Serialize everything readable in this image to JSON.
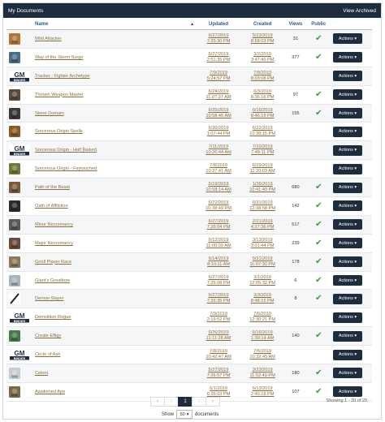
{
  "header": {
    "title": "My Documents",
    "archived_label": "View Archived"
  },
  "columns": {
    "name": "Name",
    "updated": "Updated",
    "created": "Created",
    "views": "Views",
    "public": "Public",
    "sort_arrow": "▲"
  },
  "action_label": "Actions ▾",
  "rows": [
    {
      "name": "Wild Attacker",
      "thumb": "#b0743c",
      "updated": [
        "6/27/2019",
        "7:25:30 PM"
      ],
      "created": [
        "5/23/2019",
        "8:58:03 PM"
      ],
      "views": "31",
      "public": "✔"
    },
    {
      "name": "Way of the Storm Surge",
      "thumb": "#4a6e8a",
      "updated": [
        "6/27/2019",
        "2:51:35 PM"
      ],
      "created": [
        "3/2/2019",
        "3:47:40 PM"
      ],
      "views": "377",
      "public": "✔"
    },
    {
      "name": "Tracker - Fighter Archetype",
      "thumb": "gm",
      "updated": [
        "7/9/2019",
        "5:24:57 PM"
      ],
      "created": [
        "7/8/2019",
        "8:03:08 PM"
      ],
      "views": "",
      "public": ""
    },
    {
      "name": "Thrown Weapon Master",
      "thumb": "#5a4a3a",
      "updated": [
        "6/24/2019",
        "11:07:37 AM"
      ],
      "created": [
        "6/3/2019",
        "8:36:16 PM"
      ],
      "views": "97",
      "public": "✔"
    },
    {
      "name": "Stone Domain",
      "thumb": "#3a3a3a",
      "updated": [
        "6/25/2019",
        "10:58:45 AM"
      ],
      "created": [
        "6/16/2019",
        "8:46:19 PM"
      ],
      "views": "155",
      "public": "✔"
    },
    {
      "name": "Sorcerous Origin Spells",
      "thumb": "#8a5a2a",
      "updated": [
        "6/30/2019",
        "1:07:44 PM"
      ],
      "created": [
        "6/22/2019",
        "10:38:15 PM"
      ],
      "views": "",
      "public": ""
    },
    {
      "name": "Sorcerous Origin - Half Raised",
      "thumb": "gm",
      "updated": [
        "7/11/2019",
        "10:20:44 AM"
      ],
      "created": [
        "7/10/2019",
        "7:49:11 PM"
      ],
      "views": "",
      "public": ""
    },
    {
      "name": "Sorcerous Origin - Feytouched",
      "thumb": "#6a7a3a",
      "updated": [
        "7/8/2019",
        "10:37:41 AM"
      ],
      "created": [
        "6/29/2019",
        "11:20:03 AM"
      ],
      "views": "",
      "public": ""
    },
    {
      "name": "Path of the Beast",
      "thumb": "#7a5a3a",
      "updated": [
        "6/19/2019",
        "10:58:14 AM"
      ],
      "created": [
        "1/26/2019",
        "10:41:40 PM"
      ],
      "views": "680",
      "public": "✔"
    },
    {
      "name": "Oath of Affliction",
      "thumb": "#2a2a2a",
      "updated": [
        "6/22/2019",
        "10:38:49 PM"
      ],
      "created": [
        "6/21/2019",
        "12:38:58 PM"
      ],
      "views": "142",
      "public": "✔"
    },
    {
      "name": "Minor Necromancy",
      "thumb": "#5a5a5a",
      "updated": [
        "6/27/2019",
        "7:26:04 PM"
      ],
      "created": [
        "2/21/2019",
        "4:27:36 PM"
      ],
      "views": "517",
      "public": "✔"
    },
    {
      "name": "Major Necromancy",
      "thumb": "#6a4a3a",
      "updated": [
        "6/12/2019",
        "11:00:39 AM"
      ],
      "created": [
        "3/13/2019",
        "3:01:44 PM"
      ],
      "views": "239",
      "public": "✔"
    },
    {
      "name": "Gnoll Player Race",
      "thumb": "#8a7a5a",
      "updated": [
        "6/14/2019",
        "8:10:11 AM"
      ],
      "created": [
        "5/31/2019",
        "11:07:30 PM"
      ],
      "views": "178",
      "public": "✔"
    },
    {
      "name": "Giant's Greatbow",
      "thumb": "#aab4bc",
      "updated": [
        "6/27/2019",
        "7:25:08 PM"
      ],
      "created": [
        "3/1/2019",
        "12:05:32 PM"
      ],
      "views": "6",
      "public": "✔"
    },
    {
      "name": "Demon Slayer",
      "thumb": "blade",
      "updated": [
        "5/27/2019",
        "7:26:35 PM"
      ],
      "created": [
        "3/3/2019",
        "8:48:15 PM"
      ],
      "views": "8",
      "public": "✔"
    },
    {
      "name": "Demolition Rogue",
      "thumb": "gm",
      "updated": [
        "7/9/2019",
        "2:19:52 PM"
      ],
      "created": [
        "7/6/2019",
        "12:30:21 PM"
      ],
      "views": "",
      "public": ""
    },
    {
      "name": "Create Effigy",
      "thumb": "#4a7a4a",
      "updated": [
        "6/26/2019",
        "11:11:28 AM"
      ],
      "created": [
        "6/16/2019",
        "1:30:14 AM"
      ],
      "views": "140",
      "public": "✔"
    },
    {
      "name": "Circle of Ash",
      "thumb": "gm",
      "updated": [
        "7/8/2019",
        "10:42:47 AM"
      ],
      "created": [
        "7/6/2019",
        "10:32:45 AM"
      ],
      "views": "",
      "public": ""
    },
    {
      "name": "Celoni",
      "thumb": "#c8cdd2",
      "updated": [
        "5/27/2019",
        "7:26:57 PM"
      ],
      "created": [
        "3/23/2019",
        "11:52:49 PM"
      ],
      "views": "180",
      "public": "✔"
    },
    {
      "name": "Awakened Ape",
      "thumb": "#7a6a4a",
      "updated": [
        "6/1/2019",
        "6:25:03 PM"
      ],
      "created": [
        "5/13/2019",
        "2:40:18 PM"
      ],
      "views": "107",
      "public": "✔"
    }
  ],
  "pagination": {
    "prev2": "«",
    "prev": "‹",
    "current": "1",
    "next": "›",
    "next2": "»"
  },
  "showing": "Showing 1 - 20 of 20",
  "show": {
    "prefix": "Show",
    "value": "50",
    "suffix": "documents"
  },
  "colors": {
    "primary": "#1e2d3d",
    "link": "#8a6d3b",
    "check": "#3a9a3a"
  }
}
